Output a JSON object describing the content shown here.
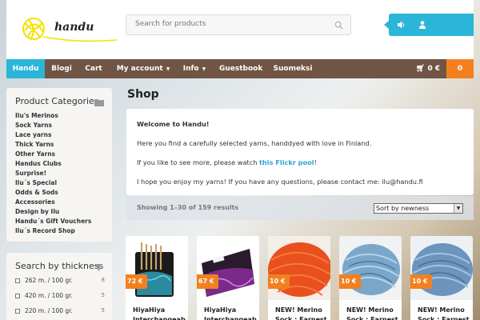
{
  "header": {
    "logo_text": "handu",
    "search_placeholder": "Search for products",
    "tools": [
      "volume-icon",
      "user-icon"
    ]
  },
  "nav": {
    "items": [
      {
        "label": "Handu",
        "active": true
      },
      {
        "label": "Blogi"
      },
      {
        "label": "Cart"
      },
      {
        "label": "My account",
        "dropdown": true
      },
      {
        "label": "Info",
        "dropdown": true
      },
      {
        "label": "Guestbook"
      },
      {
        "label": "Suomeksi"
      }
    ],
    "cart_total": "0 €",
    "cart_count": "0"
  },
  "sidebar": {
    "categories_title": "Product Categories",
    "categories": [
      "Ilu's Merinos",
      "Sock Yarns",
      "Lace yarns",
      "Thick Yarns",
      "Other Yarns",
      "Handus Clubs",
      "Surprise!",
      "Ilu´s Special",
      "Odds & Sods",
      "Accessories",
      "Design by Ilu",
      "Handu´s Gift Vouchers",
      "Ilu´s Record Shop"
    ],
    "thickness_title": "Search by thickness",
    "thickness": [
      {
        "label": "262 m. / 100 gr.",
        "count": "8"
      },
      {
        "label": "420 m. / 100 gr.",
        "count": "5"
      },
      {
        "label": "220 m. / 100 gr.",
        "count": "5"
      }
    ]
  },
  "main": {
    "title": "Shop",
    "welcome": {
      "heading": "Welcome to Handu!",
      "line1": "Here you find a carefully selected yarns, handdyed with love in Finland.",
      "line2_before": "If you like to see more, please watch ",
      "line2_link": "this Flickr pool",
      "line2_after": "!",
      "line3": "I hope you enjoy my yarns! If you have any questions, please contact me: ilu@handu.fi"
    },
    "results": "Showing 1–30 of 159 results",
    "sort": "Sort by newness",
    "products": [
      {
        "price": "72 €",
        "name": "HiyaHiya Interchangeab",
        "image": "needle-case-teal"
      },
      {
        "price": "67 €",
        "name": "HiyaHiya Interchangeab",
        "image": "needle-case-purple"
      },
      {
        "price": "10 €",
        "name": "NEW! Merino Sock : Earnest",
        "image": "yarn-orange"
      },
      {
        "price": "10 €",
        "name": "NEW! Merino Sock : Earnest",
        "image": "yarn-blue-light"
      },
      {
        "price": "10 €",
        "name": "NEW! Merino Sock : Earnest",
        "image": "yarn-blue"
      }
    ]
  },
  "colors": {
    "accent": "#2bb5d8",
    "nav": "#705544",
    "price": "#f2801f",
    "link": "#2ba4cf"
  }
}
